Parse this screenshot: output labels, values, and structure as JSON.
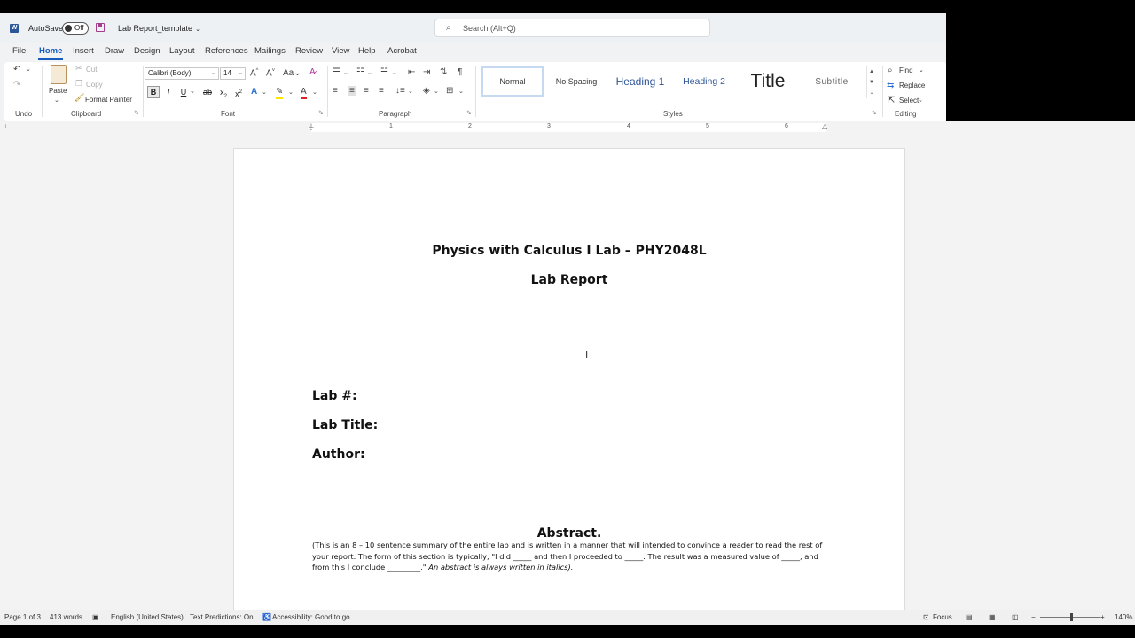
{
  "titlebar": {
    "autosave_label": "AutoSave",
    "autosave_state": "Off",
    "doc_name": "Lab Report_template",
    "search_placeholder": "Search (Alt+Q)"
  },
  "tabs": [
    "File",
    "Home",
    "Insert",
    "Draw",
    "Design",
    "Layout",
    "References",
    "Mailings",
    "Review",
    "View",
    "Help",
    "Acrobat"
  ],
  "active_tab": "Home",
  "ribbon": {
    "undo_group": "Undo",
    "clipboard": {
      "paste": "Paste",
      "cut": "Cut",
      "copy": "Copy",
      "format_painter": "Format Painter",
      "group": "Clipboard"
    },
    "font": {
      "name": "Calibri (Body)",
      "size": "14",
      "group": "Font"
    },
    "paragraph": {
      "group": "Paragraph"
    },
    "styles": {
      "items": [
        "Normal",
        "No Spacing",
        "Heading 1",
        "Heading 2",
        "Title",
        "Subtitle"
      ],
      "group": "Styles"
    },
    "editing": {
      "find": "Find",
      "replace": "Replace",
      "select": "Select",
      "group": "Editing"
    }
  },
  "ruler_numbers": [
    "1",
    "2",
    "3",
    "4",
    "5",
    "6"
  ],
  "document": {
    "title1": "Physics with Calculus I Lab – PHY2048L",
    "title2": "Lab Report",
    "lab_num": "Lab #:",
    "lab_title": "Lab Title:",
    "author": "Author:",
    "abstract_heading": "Abstract.",
    "abstract_text": "(This is an 8 – 10 sentence summary of the entire lab and is written in a manner that will intended to convince a reader to read the rest of your report.  The form of this section is typically, \"I did _____ and then I proceeded to _____.  The result was a measured value of _____, and from this I conclude _________.\"",
    "abstract_italic": "An abstract is always written in italics)."
  },
  "statusbar": {
    "page": "Page 1 of 3",
    "words": "413 words",
    "language": "English (United States)",
    "predictions": "Text Predictions: On",
    "accessibility": "Accessibility: Good to go",
    "focus": "Focus",
    "zoom": "140%"
  },
  "colors": {
    "accent": "#185abd",
    "word_blue": "#2b579a"
  }
}
